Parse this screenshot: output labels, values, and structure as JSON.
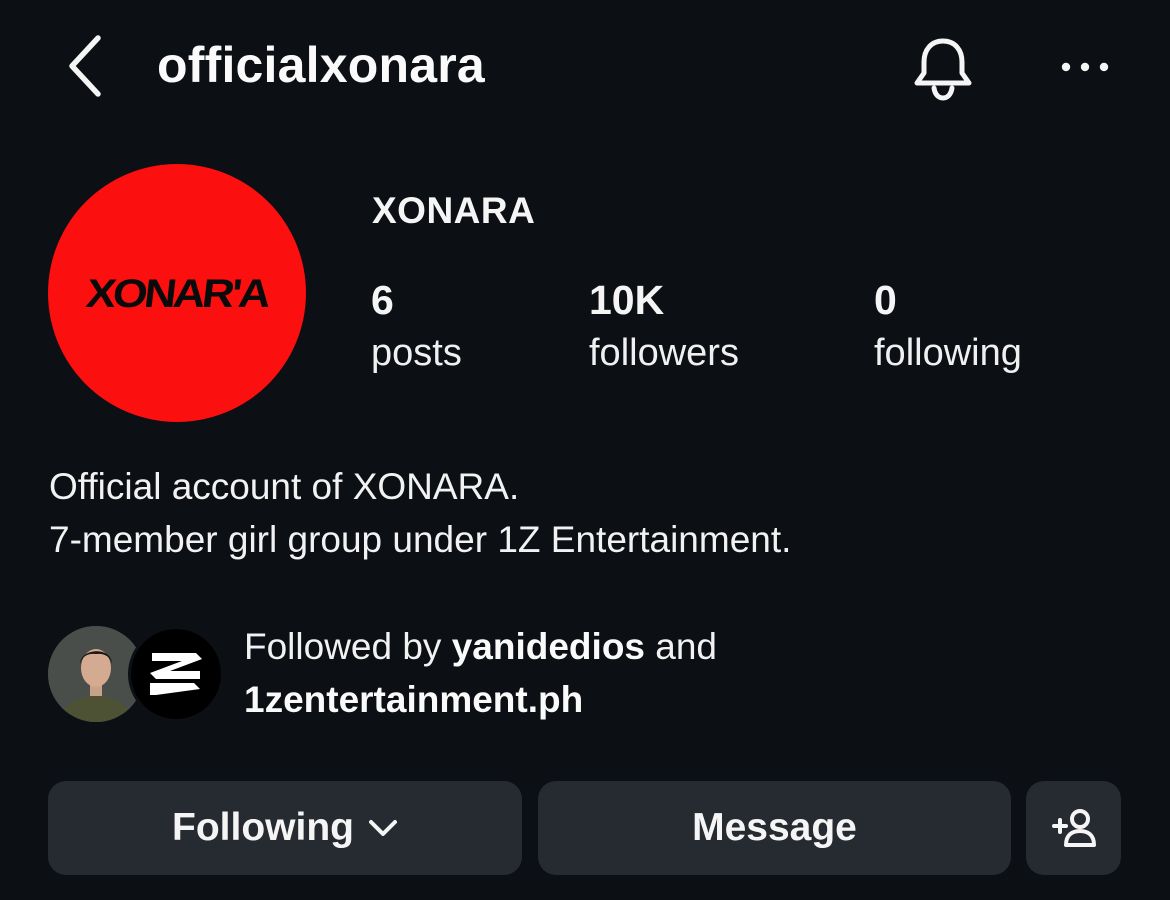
{
  "header": {
    "username": "officialxonara",
    "back_icon": "chevron-left-icon",
    "notification_icon": "bell-icon",
    "more_icon": "more-horizontal-icon"
  },
  "profile": {
    "avatar_logo_text": "XONAR'A",
    "avatar_color": "#fb0f0f",
    "display_name": "XONARA",
    "stats": {
      "posts": {
        "count": "6",
        "label": "posts"
      },
      "followers": {
        "count": "10K",
        "label": "followers"
      },
      "following": {
        "count": "0",
        "label": "following"
      }
    },
    "bio": [
      "Official account of XONARA.",
      "7-member girl group under 1Z Entertainment."
    ]
  },
  "followed_by": {
    "prefix": "Followed by ",
    "user1": "yanidedios",
    "conjunction": " and",
    "user2": "1zentertainment.ph"
  },
  "actions": {
    "following_label": "Following",
    "message_label": "Message",
    "add_person_icon": "add-person-icon"
  },
  "colors": {
    "background": "#0c0f14",
    "button_bg": "#262a31",
    "text": "#f5f5f5"
  }
}
